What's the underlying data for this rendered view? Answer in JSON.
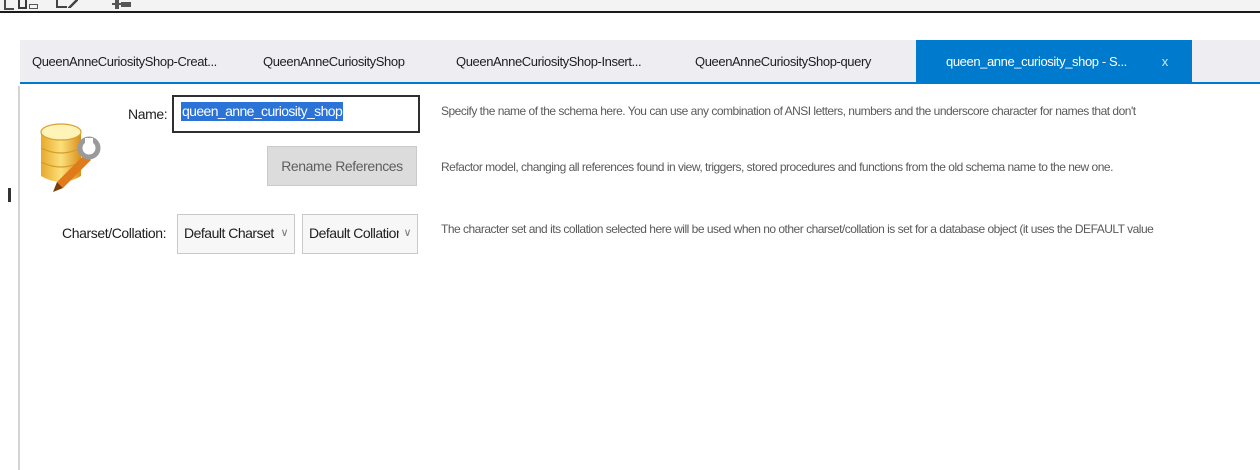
{
  "tabs": [
    {
      "label": "QueenAnneCuriosityShop-Creat..."
    },
    {
      "label": "QueenAnneCuriosityShop"
    },
    {
      "label": "QueenAnneCuriosityShop-Insert..."
    },
    {
      "label": "QueenAnneCuriosityShop-query"
    }
  ],
  "active_tab": {
    "label": "queen_anne_curiosity_shop - S...",
    "close": "x"
  },
  "form": {
    "name_label": "Name:",
    "name_value": "queen_anne_curiosity_shop",
    "rename_button": "Rename References",
    "charset_label": "Charset/Collation:",
    "charset_value": "Default Charset",
    "collation_value": "Default Collation"
  },
  "help": {
    "name": "Specify the name of the schema here. You can use any combination of ANSI letters, numbers and the underscore character for names that don't",
    "rename": "Refactor model, changing all references found in view, triggers, stored procedures and functions from the old schema name to the new one.",
    "charset": "The character set and its collation selected here will be used when no other charset/collation is set for a database object (it uses the DEFAULT value"
  },
  "colors": {
    "accent": "#007acc",
    "selection": "#2b73d6"
  },
  "icons": {
    "schema": "database-schema-icon",
    "dropdown": "chevron-down-icon"
  }
}
